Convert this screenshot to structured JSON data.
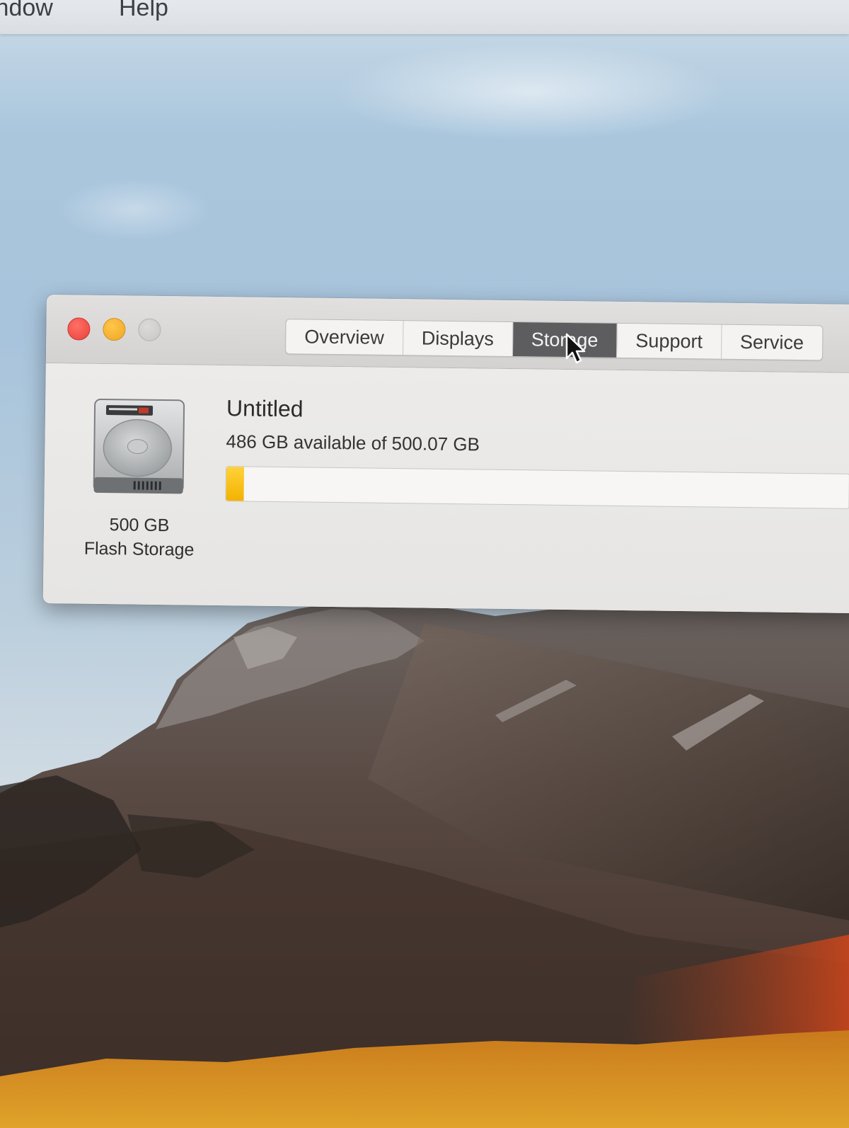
{
  "menubar": {
    "items": [
      "Window",
      "Help"
    ],
    "visible_window_text": "indow"
  },
  "window": {
    "traffic_lights": {
      "close_color": "#ec4c43",
      "minimize_color": "#f5b12b",
      "zoom_color": "#cfcdcc"
    },
    "tabs": [
      {
        "label": "Overview",
        "active": false
      },
      {
        "label": "Displays",
        "active": false
      },
      {
        "label": "Storage",
        "active": true
      },
      {
        "label": "Support",
        "active": false
      },
      {
        "label": "Service",
        "active": false
      }
    ]
  },
  "storage": {
    "disk_icon": "hard-drive-icon",
    "disk_size": "500 GB",
    "disk_type": "Flash Storage",
    "volume_name": "Untitled",
    "availability_text": "486 GB available of 500.07 GB",
    "used_fraction": 0.028,
    "used_color": "#f5b800"
  }
}
